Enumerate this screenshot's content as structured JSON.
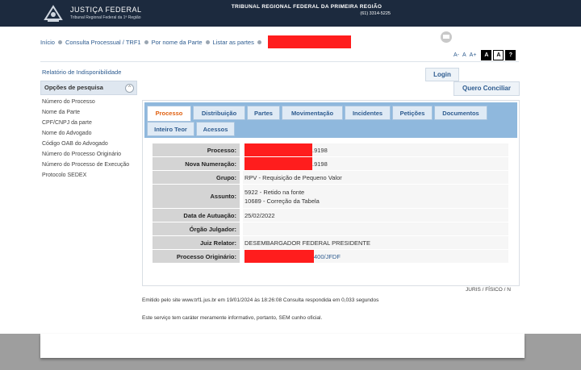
{
  "header": {
    "logo_title": "JUSTIÇA FEDERAL",
    "logo_subtitle": "Tribunal Regional Federal da 1ª Região",
    "court_title": "TRIBUNAL REGIONAL FEDERAL DA PRIMEIRA REGIÃO",
    "court_phone": "(61) 3314-5225"
  },
  "breadcrumb": {
    "items": [
      "Início",
      "Consulta Processual / TRF1",
      "Por nome da Parte",
      "Listar as partes"
    ]
  },
  "font_controls": {
    "decrease": "A-",
    "normal": "A",
    "increase": "A+",
    "contrast_dark": "A",
    "contrast_light": "A",
    "help": "?"
  },
  "sidebar": {
    "link": "Relatório de Indisponibilidade",
    "search_header": "Opções de pesquisa",
    "search_items": [
      "Número do Processo",
      "Nome da Parte",
      "CPF/CNPJ da parte",
      "Nome do Advogado",
      "Código OAB do Advogado",
      "Número do Processo Originário",
      "Número do Processo de Execução",
      "Protocolo SEDEX"
    ]
  },
  "buttons": {
    "login": "Login",
    "conciliar": "Quero Conciliar"
  },
  "tabs": [
    "Processo",
    "Distribuição",
    "Partes",
    "Movimentação",
    "Incidentes",
    "Petições",
    "Documentos",
    "Inteiro Teor",
    "Acessos"
  ],
  "details": {
    "processo": {
      "label": "Processo:",
      "value": ".9198"
    },
    "nova_numeracao": {
      "label": "Nova Numeração:",
      "value": ".9198"
    },
    "grupo": {
      "label": "Grupo:",
      "value": "RPV - Requisição de Pequeno Valor"
    },
    "assunto": {
      "label": "Assunto:",
      "value1": "5922 - Retido na fonte",
      "value2": "10689 - Correção da Tabela"
    },
    "data_autuacao": {
      "label": "Data de Autuação:",
      "value": "25/02/2022"
    },
    "orgao_julgador": {
      "label": "Órgão Julgador:",
      "value": ""
    },
    "juiz_relator": {
      "label": "Juiz Relator:",
      "value": "DESEMBARGADOR FEDERAL PRESIDENTE"
    },
    "processo_originario": {
      "label": "Processo Originário:",
      "value": "400/JFDF"
    }
  },
  "footer": {
    "juris": "JURIS / FÍSICO / N",
    "emitted": "Emitido pelo site www.trf1.jus.br em 19/01/2024 às 18:26:08 Consulta respondida em 0,033 segundos",
    "disclaimer": "Este serviço tem caráter meramente informativo, portanto, SEM cunho oficial."
  },
  "colors": {
    "header_bg": "#1c2a3e",
    "tabbar_bg": "#8fb8dd",
    "active_tab_text": "#e06010",
    "link": "#2d5b8f",
    "redaction": "#ff1d1d"
  }
}
